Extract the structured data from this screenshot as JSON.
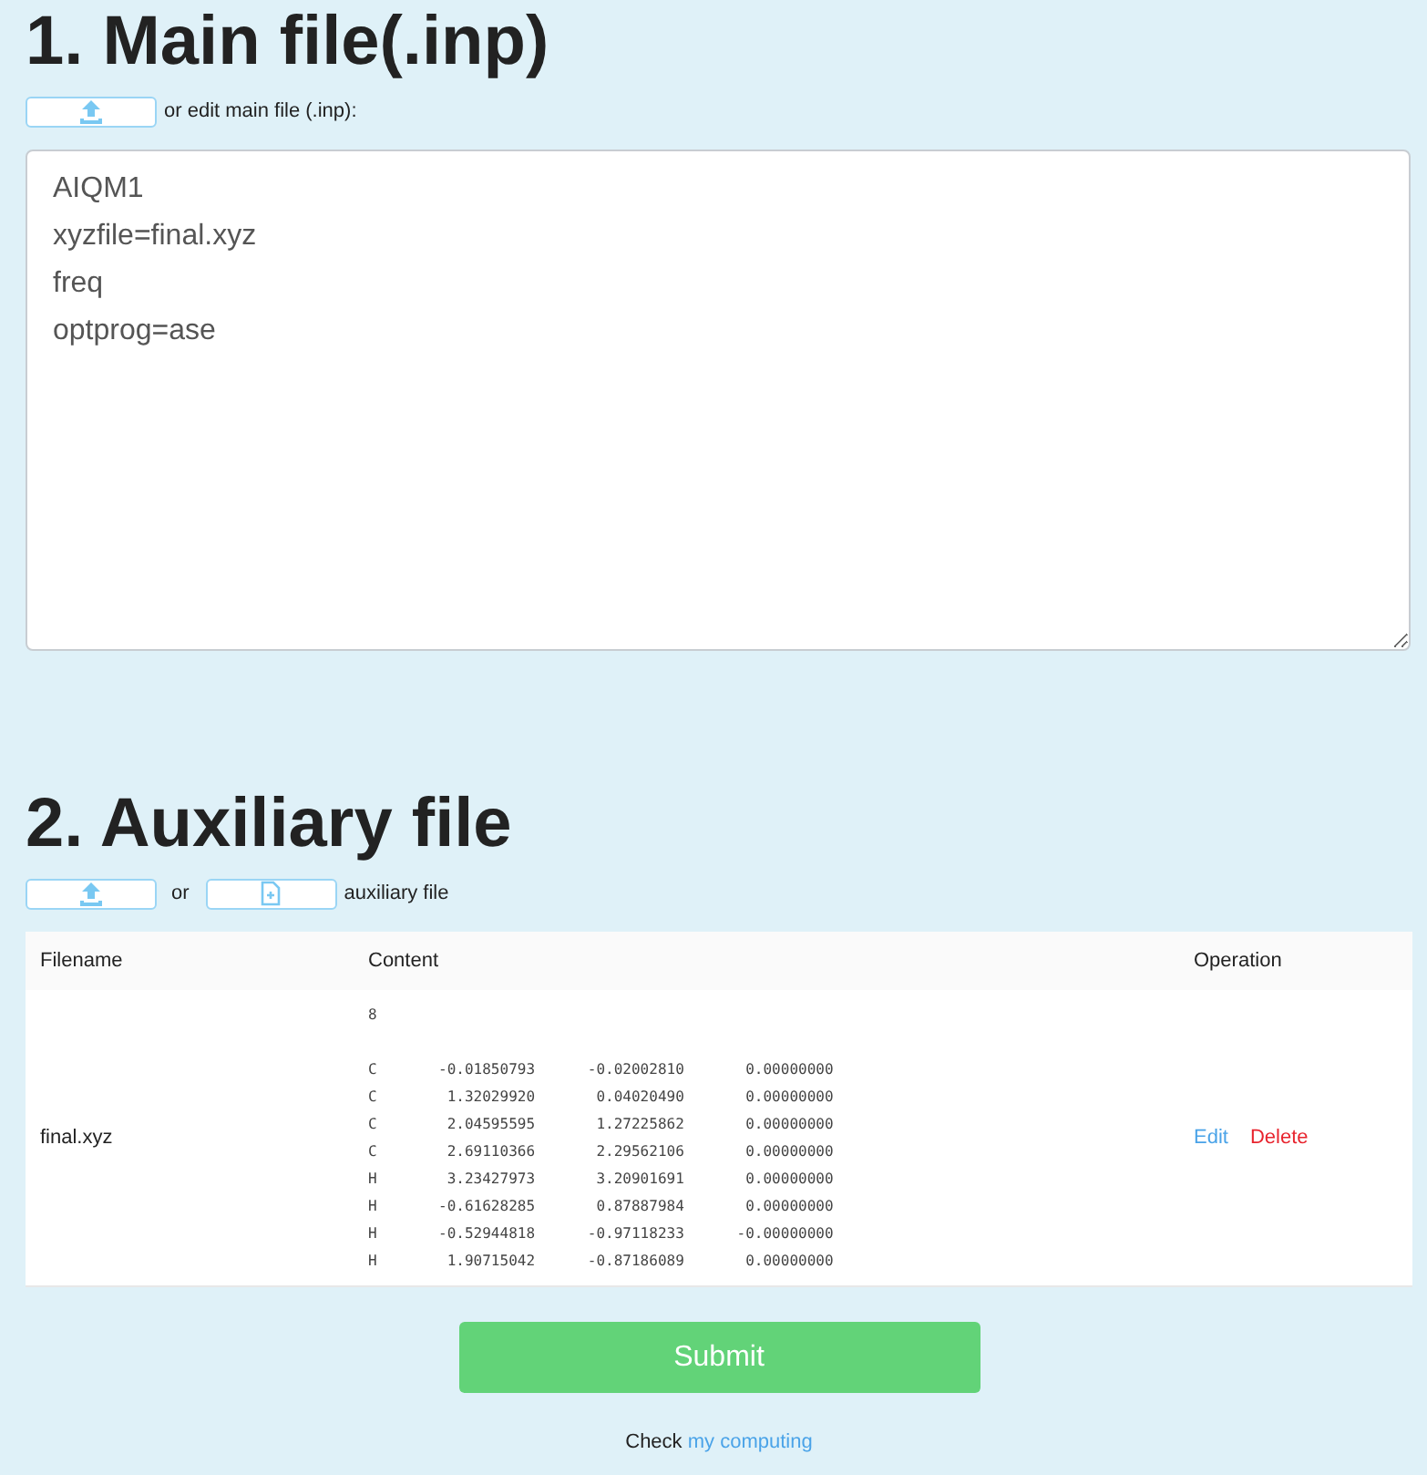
{
  "main_section": {
    "title": "1. Main file(.inp)",
    "upload_hint": "or edit main file (.inp):",
    "editor_value": "AIQM1\nxyzfile=final.xyz\nfreq\noptprog=ase"
  },
  "aux_section": {
    "title": "2. Auxiliary file",
    "or_text": "or",
    "hint": "auxiliary file",
    "table": {
      "columns": [
        "Filename",
        "Content",
        "Operation"
      ],
      "rows": [
        {
          "filename": "final.xyz",
          "content": "8\n\nC       -0.01850793      -0.02002810       0.00000000\nC        1.32029920       0.04020490       0.00000000\nC        2.04595595       1.27225862       0.00000000\nC        2.69110366       2.29562106       0.00000000\nH        3.23427973       3.20901691       0.00000000\nH       -0.61628285       0.87887984       0.00000000\nH       -0.52944818      -0.97118233      -0.00000000\nH        1.90715042      -0.87186089       0.00000000",
          "actions": [
            "Edit",
            "Delete"
          ]
        }
      ]
    }
  },
  "submit": "Submit",
  "footer": {
    "text": "Check",
    "link": "my computing"
  }
}
